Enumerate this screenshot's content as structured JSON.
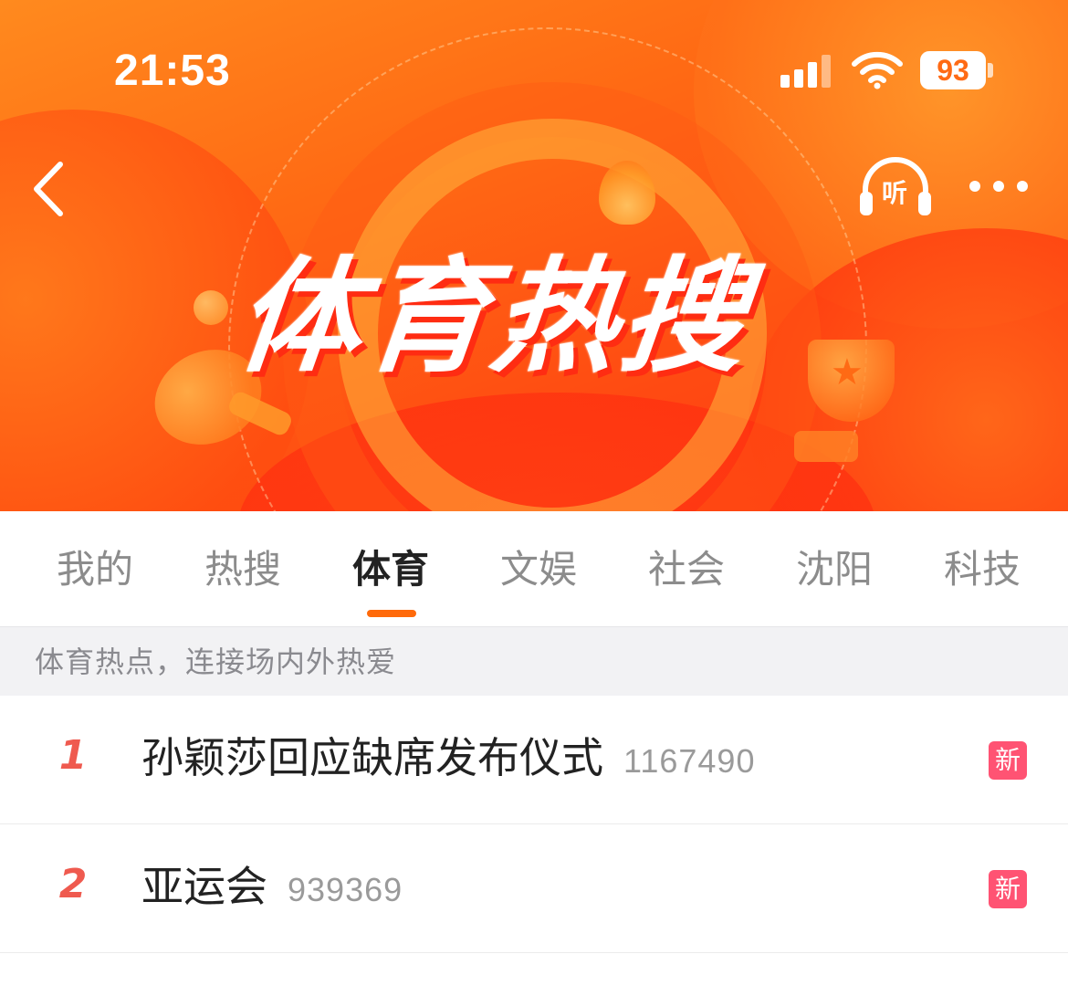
{
  "status_bar": {
    "time": "21:53",
    "battery": "93"
  },
  "header": {
    "title": "体育热搜",
    "listen_label": "听"
  },
  "tabs": [
    {
      "label": "我的",
      "active": false
    },
    {
      "label": "热搜",
      "active": false
    },
    {
      "label": "体育",
      "active": true
    },
    {
      "label": "文娱",
      "active": false
    },
    {
      "label": "社会",
      "active": false
    },
    {
      "label": "沈阳",
      "active": false
    },
    {
      "label": "科技",
      "active": false
    }
  ],
  "subheader": {
    "text": "体育热点，连接场内外热爱"
  },
  "list": [
    {
      "rank": "1",
      "title": "孙颖莎回应缺席发布仪式",
      "count": "1167490",
      "badge": "新"
    },
    {
      "rank": "2",
      "title": "亚运会",
      "count": "939369",
      "badge": "新"
    }
  ],
  "colors": {
    "accent": "#ff6a0a",
    "rank": "#ef5a4f",
    "badge": "#ff5373"
  }
}
